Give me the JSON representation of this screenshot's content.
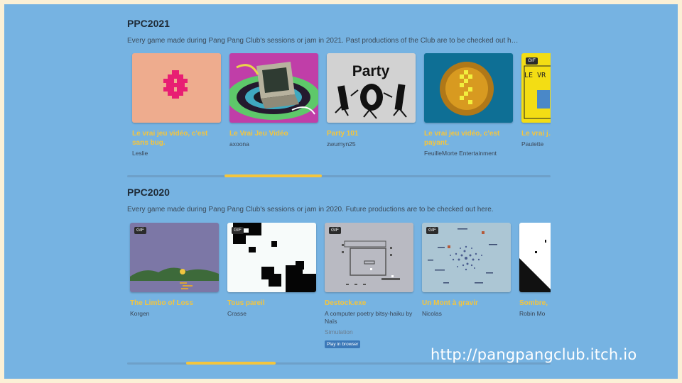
{
  "site_url": "http://pangpangclub.itch.io",
  "sections": [
    {
      "title": "PPC2021",
      "description": "Every game made during Pang Pang Club's sessions or jam in 2021. Past productions of the Club are to be checked out h…",
      "games": [
        {
          "title": "Le vrai jeu vidéo, c'est sans bug.",
          "author": "Leslie",
          "gif": false,
          "thumb_icon": "pink-pixel-bug-icon"
        },
        {
          "title": "Le Vrai Jeu Vidéo",
          "author": "axoona",
          "gif": false,
          "thumb_icon": "retro-computer-icon"
        },
        {
          "title": "Party 101",
          "author": "zwumyn25",
          "gif": false,
          "thumb_text": "Party",
          "thumb_icon": "dancing-numbers-icon"
        },
        {
          "title": "Le vrai jeu vidéo, c'est payant.",
          "author": "FeuilleMorte Entertainment",
          "gif": false,
          "thumb_icon": "pixel-coin-icon"
        },
        {
          "title": "Le vrai j… Généra…",
          "author": "Paulette",
          "gif": true,
          "thumb_text": "LE VR",
          "thumb_icon": "yellow-screen-icon"
        }
      ],
      "scroll": {
        "position": 0.23,
        "size": 0.23
      }
    },
    {
      "title": "PPC2020",
      "description": "Every game made during Pang Pang Club's sessions or jam in 2020. Future productions are to be checked out",
      "link_text": "here",
      "link_suffix": ".",
      "games": [
        {
          "title": "The Limbo of Loss",
          "author": "Korgen",
          "gif": true,
          "thumb_icon": "purple-landscape-icon"
        },
        {
          "title": "Tous pareil",
          "author": "Crasse",
          "gif": true,
          "thumb_icon": "black-pixel-blocks-icon"
        },
        {
          "title": "Destock.exe",
          "description": "A computer poetry bitsy-haiku by Naïs",
          "genre": "Simulation",
          "platform": "Play in browser",
          "gif": true,
          "thumb_icon": "bitsy-room-icon"
        },
        {
          "title": "Un Mont à gravir",
          "author": "Nicolas",
          "gif": true,
          "thumb_icon": "dotted-mountain-icon"
        },
        {
          "title": "Sombre,",
          "author": "Robin Mo",
          "gif": false,
          "thumb_icon": "dark-diagonal-icon"
        }
      ],
      "scroll": {
        "position": 0.14,
        "size": 0.21
      }
    }
  ],
  "colors": {
    "background": "#76b3e2",
    "accent": "#f4c53d",
    "border": "#fbf0d6"
  }
}
